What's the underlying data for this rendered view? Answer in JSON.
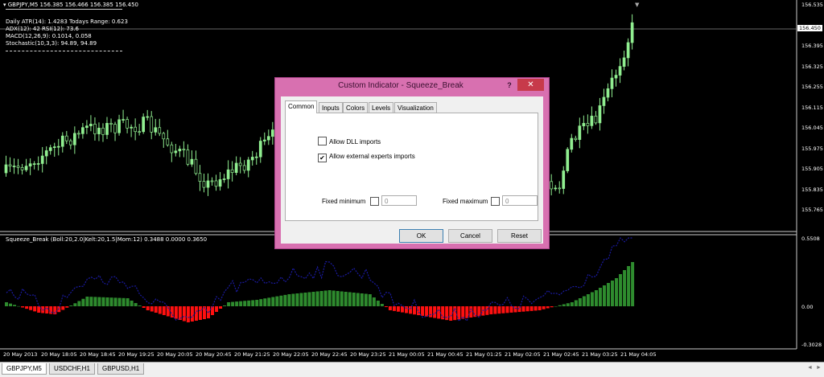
{
  "chart": {
    "header": "GBPJPY,M5  156.385 156.466 156.385 156.450",
    "info_lines": [
      "Daily ATR(14): 1.4283 Todays Range: 0.623",
      "ADX(12): 42 RSI(12): 73.6",
      "MACD(12,26,9): 0.1014, 0.058",
      "Stochastic(10,3,3): 94.89, 94.89"
    ],
    "price_ticks": [
      "156.535",
      "156.395",
      "156.325",
      "156.255",
      "156.115",
      "156.045",
      "155.975",
      "155.905",
      "155.835",
      "155.765"
    ],
    "current_price": "156.450",
    "indicator_header": "Squeeze_Break (Boll:20,2.0|Kelt:20,1.5|Mom:12) 0.3488 0.0000 0.3650",
    "indicator_ticks": [
      "0.5508",
      "0.00",
      "-0.3028"
    ],
    "time_ticks": [
      "20 May 2013",
      "20 May 18:05",
      "20 May 18:45",
      "20 May 19:25",
      "20 May 20:05",
      "20 May 20:45",
      "20 May 21:25",
      "20 May 22:05",
      "20 May 22:45",
      "20 May 23:25",
      "21 May 00:05",
      "21 May 00:45",
      "21 May 01:25",
      "21 May 02:05",
      "21 May 02:45",
      "21 May 03:25",
      "21 May 04:05"
    ],
    "colors": {
      "bull_candle": "#90ee90",
      "bull_hist": "#2e8b2e",
      "bear_hist": "#ff1010",
      "dotted_line": "#1a1aa0"
    }
  },
  "chart_data": {
    "type": "candlestick",
    "price_range": [
      155.765,
      156.535
    ],
    "indicator_range": [
      -0.3028,
      0.5508
    ]
  },
  "tabs": [
    "GBPJPY,M5",
    "USDCHF,H1",
    "GBPUSD,H1"
  ],
  "tab_scroll": [
    "◄",
    "►"
  ],
  "dialog": {
    "title": "Custom Indicator - Squeeze_Break",
    "help": "?",
    "close": "✕",
    "tabs": [
      "Common",
      "Inputs",
      "Colors",
      "Levels",
      "Visualization"
    ],
    "allow_dll": "Allow DLL imports",
    "allow_experts": "Allow external experts imports",
    "allow_experts_check": "✔",
    "fixed_min_label": "Fixed minimum",
    "fixed_min_value": "0",
    "fixed_max_label": "Fixed maximum",
    "fixed_max_value": "0",
    "ok": "OK",
    "cancel": "Cancel",
    "reset": "Reset"
  }
}
